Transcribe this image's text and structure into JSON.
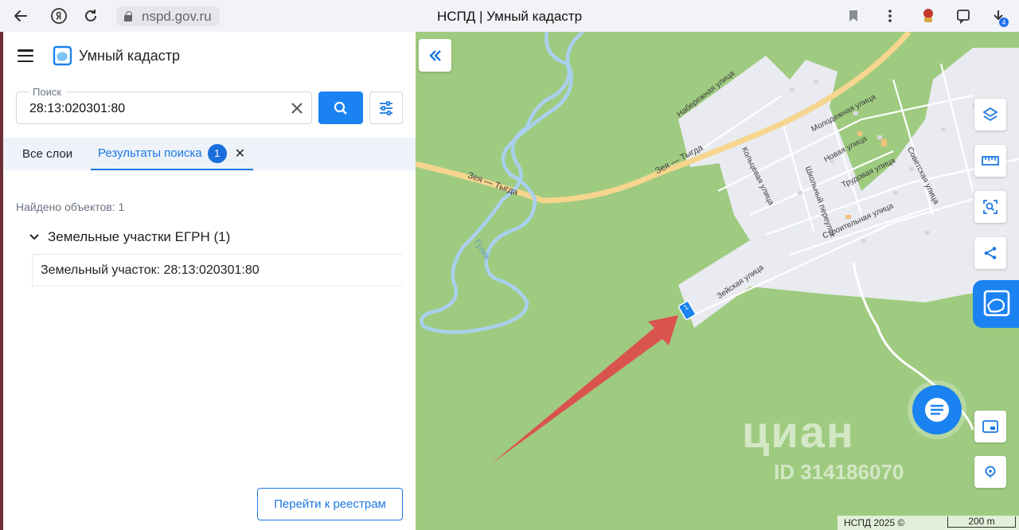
{
  "browser": {
    "url": "nspd.gov.ru",
    "page_title": "НСПД | Умный кадастр",
    "downloads_count": "4"
  },
  "app": {
    "title": "Умный кадастр"
  },
  "search": {
    "label": "Поиск",
    "value": "28:13:020301:80"
  },
  "tabs": {
    "all_layers": "Все слои",
    "results": "Результаты поиска",
    "results_count": "1"
  },
  "results": {
    "found_text": "Найдено объектов: 1",
    "group_label": "Земельные участки ЕГРН (1)",
    "item_label": "Земельный участок: 28:13:020301:80"
  },
  "registry_button": "Перейти к реестрам",
  "map": {
    "road_labels": {
      "highway": "Зея — Тыгда",
      "highway2": "Зея — Тыгда",
      "river": "Гулик",
      "street_naberezhnaya": "Набережная улица",
      "street_molodezhnaya": "Молодежная улица",
      "street_novaya": "Новая улица",
      "street_trudovaya": "Трудовая улица",
      "street_stroitelnaya": "Строительная улица",
      "street_zeyskaya": "Зейская улица",
      "street_koltsevaya": "Кольцевая улица",
      "street_shkolny": "Школьный переулок",
      "street_sovetskaya": "Советская улица"
    },
    "watermark": "циан",
    "watermark_id": "ID 314186070",
    "copyright": "НСПД 2025 ©",
    "scale_label": "200 m",
    "parcel_marker": "1"
  },
  "colors": {
    "accent": "#1b82f1",
    "forest": "#9fcb80",
    "road": "#f6d58e",
    "river": "#a9d0ee",
    "settlement": "#e8eaf0",
    "arrow": "#d9534f"
  }
}
